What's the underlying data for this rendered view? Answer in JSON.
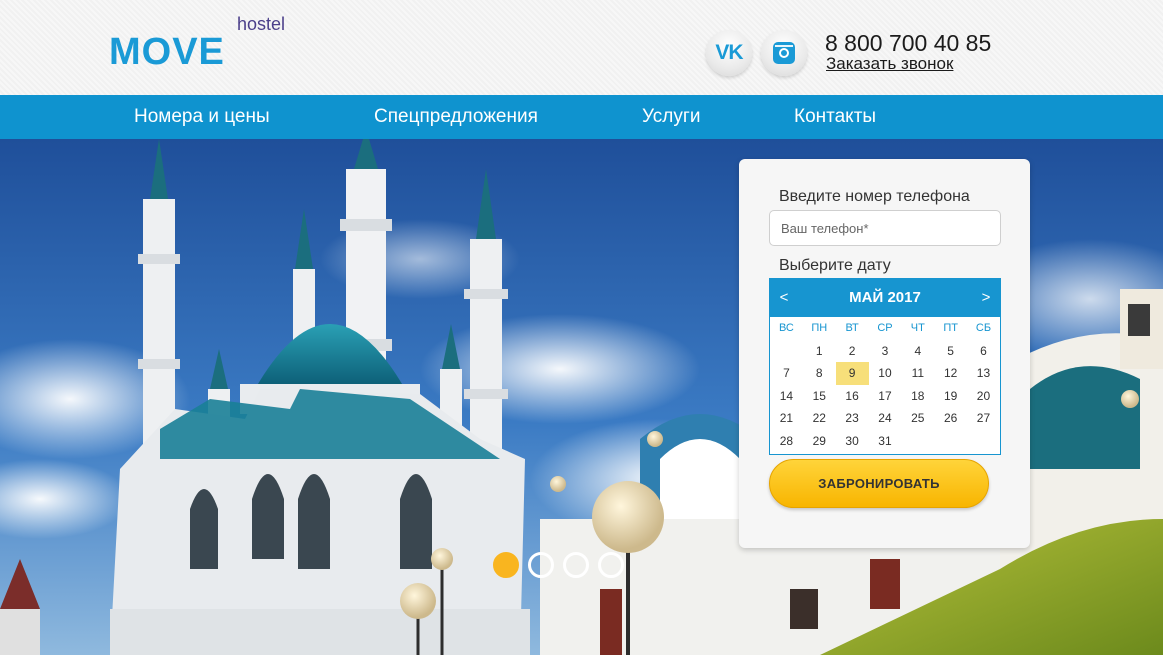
{
  "brand": {
    "name": "MOVE",
    "sub": "hostel",
    "color": "#1a9ad6"
  },
  "social": [
    {
      "icon": "vk-icon",
      "glyph": "VK"
    },
    {
      "icon": "instagram-icon"
    }
  ],
  "contact": {
    "phone": "8 800 700 40 85",
    "callback_label": "Заказать звонок"
  },
  "nav": {
    "items": [
      "Номера и цены",
      "Спецпредложения",
      "Услуги",
      "Контакты"
    ],
    "color": "#0f93cf"
  },
  "slider": {
    "dots": 4,
    "active": 1,
    "accent": "#f9b51f"
  },
  "booking": {
    "phone_label": "Введите номер телефона",
    "phone_placeholder": "Ваш телефон*",
    "phone_value": "",
    "date_label": "Выберите дату",
    "calendar": {
      "title": "МАЙ 2017",
      "prev": "<",
      "next": ">",
      "weekdays": [
        "ВС",
        "ПН",
        "ВТ",
        "СР",
        "ЧТ",
        "ПТ",
        "СБ"
      ],
      "weeks": [
        [
          "",
          "1",
          "2",
          "3",
          "4",
          "5",
          "6"
        ],
        [
          "7",
          "8",
          "9",
          "10",
          "11",
          "12",
          "13"
        ],
        [
          "14",
          "15",
          "16",
          "17",
          "18",
          "19",
          "20"
        ],
        [
          "21",
          "22",
          "23",
          "24",
          "25",
          "26",
          "27"
        ],
        [
          "28",
          "29",
          "30",
          "31",
          "",
          "",
          ""
        ]
      ],
      "selected": "9"
    },
    "submit_label": "ЗАБРОНИРОВАТЬ"
  }
}
